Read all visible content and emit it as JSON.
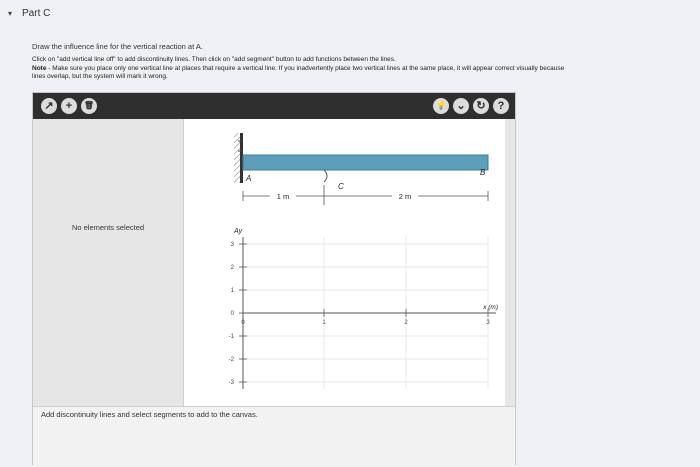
{
  "part": {
    "caret": "▾",
    "title": "Part C"
  },
  "prompt": "Draw the influence line for the vertical reaction at A.",
  "instructions": {
    "line1_lead": "Click on \"add vertical line off\" to add discontinuity lines. Then click on \"add segment\" button to add functions between the lines.",
    "line2_lead": "Note",
    "line2_rest": " - Make sure you place only one vertical line at places that require a vertical line. If you inadvertently place two vertical lines at the same place, it will appear correct visually because",
    "line3": "lines overlap, but the system will mark it wrong."
  },
  "toolbar": {
    "left_buttons": [
      {
        "name": "add-vertical-line-button",
        "glyph": "↗"
      },
      {
        "name": "add-segment-button",
        "glyph": "+"
      },
      {
        "name": "delete-button",
        "glyph": "🗑"
      }
    ],
    "right_buttons": [
      {
        "name": "hint-button",
        "glyph": "💡"
      },
      {
        "name": "dropdown-button",
        "glyph": "⌄"
      },
      {
        "name": "reset-button",
        "glyph": "↻"
      },
      {
        "name": "help-button",
        "glyph": "?"
      }
    ]
  },
  "left_panel": {
    "status": "No elements selected"
  },
  "beam": {
    "labels": {
      "a": "A",
      "b": "B",
      "c": "C"
    },
    "dims": [
      "1 m",
      "2 m"
    ]
  },
  "graph": {
    "y_label": "Ay",
    "x_label": "x (m)",
    "y_ticks": [
      "3",
      "2",
      "1",
      "0",
      "-1",
      "-2",
      "-3"
    ],
    "x_ticks": [
      "0",
      "1",
      "2",
      "3"
    ]
  },
  "status_bar": {
    "text": "Add discontinuity lines and select segments to add to the canvas."
  },
  "colors": {
    "toolbar": "#2f2f2f",
    "beam": "#5b9fb8",
    "grid": "#e3e3e3"
  }
}
